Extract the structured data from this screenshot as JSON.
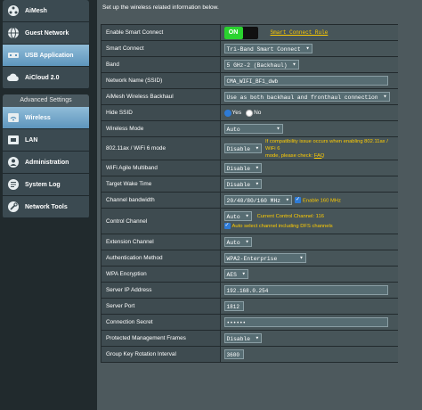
{
  "sidebar": {
    "items": [
      {
        "label": "AiMesh",
        "icon": "mesh-icon"
      },
      {
        "label": "Guest Network",
        "icon": "globe-icon"
      },
      {
        "label": "USB Application",
        "icon": "usb-icon"
      },
      {
        "label": "AiCloud 2.0",
        "icon": "cloud-icon"
      }
    ],
    "advanced_header": "Advanced Settings",
    "advanced_items": [
      {
        "label": "Wireless",
        "icon": "wifi-icon"
      },
      {
        "label": "LAN",
        "icon": "lan-icon"
      },
      {
        "label": "Administration",
        "icon": "admin-icon"
      },
      {
        "label": "System Log",
        "icon": "log-icon"
      },
      {
        "label": "Network Tools",
        "icon": "tools-icon"
      }
    ]
  },
  "main": {
    "intro": "Set up the wireless related information below.",
    "rows": {
      "smart_connect": {
        "label": "Enable Smart Connect",
        "toggle": "ON",
        "link": "Smart Connect Rule"
      },
      "smart_connect_mode": {
        "label": "Smart Connect",
        "value": "Tri-Band Smart Connect"
      },
      "band": {
        "label": "Band",
        "value": "5 GHz-2 (Backhaul)"
      },
      "ssid": {
        "label": "Network Name (SSID)",
        "value": "CMA_WIFI_BF1_dwb"
      },
      "backhaul": {
        "label": "AiMesh Wireless Backhaul",
        "value": "Use as both backhaul and fronthaul connection"
      },
      "hide_ssid": {
        "label": "Hide SSID",
        "yes": "Yes",
        "no": "No"
      },
      "wireless_mode": {
        "label": "Wireless Mode",
        "value": "Auto"
      },
      "ax_mode": {
        "label": "802.11ax / WiFi 6 mode",
        "value": "Disable",
        "hint1": "If compatibility issue occurs when enabling 802.11ax / WiFi 6",
        "hint2": "mode, please check: ",
        "hint_link": "FAQ"
      },
      "multiband": {
        "label": "WiFi Agile Multiband",
        "value": "Disable"
      },
      "twt": {
        "label": "Target Wake Time",
        "value": "Disable"
      },
      "bandwidth": {
        "label": "Channel bandwidth",
        "value": "20/40/80/160 MHz",
        "check": "Enable 160 MHz"
      },
      "control_channel": {
        "label": "Control Channel",
        "value": "Auto",
        "current": "Current Control Channel: 116",
        "check": "Auto select channel including DFS channels"
      },
      "ext_channel": {
        "label": "Extension Channel",
        "value": "Auto"
      },
      "auth": {
        "label": "Authentication Method",
        "value": "WPA2-Enterprise"
      },
      "wpa_enc": {
        "label": "WPA Encryption",
        "value": "AES"
      },
      "server_ip": {
        "label": "Server IP Address",
        "value": "192.168.0.254"
      },
      "server_port": {
        "label": "Server Port",
        "value": "1812"
      },
      "secret": {
        "label": "Connection Secret",
        "value": "••••••"
      },
      "pmf": {
        "label": "Protected Management Frames",
        "value": "Disable"
      },
      "gk_interval": {
        "label": "Group Key Rotation Interval",
        "value": "3600"
      }
    }
  },
  "colors": {
    "accent_link": "#FFCC00",
    "toggle_on": "#2ad32f",
    "checkbox": "#2e7bd6",
    "active_nav": "#6aa2c8"
  }
}
